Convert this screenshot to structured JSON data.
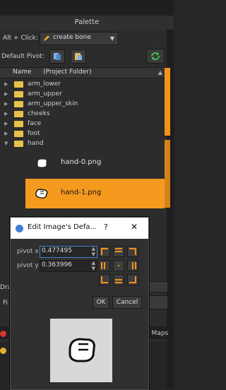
{
  "panel": {
    "title": "Palette"
  },
  "toolbar": {
    "alt_click_label": "Alt + Click:",
    "alt_click_value": "create bone",
    "default_pivot_label": "Default Pivot:"
  },
  "tree": {
    "col_name": "Name",
    "col_folder": "(Project Folder)",
    "folders": [
      "arm_lower",
      "arm_upper",
      "arm_upper_skin",
      "cheeks",
      "face",
      "foot",
      "hand"
    ],
    "files": [
      "hand-0.png",
      "hand-1.png"
    ]
  },
  "background_fragments": {
    "left1": "Dra",
    "left2": "Fi",
    "right_tab": "r Maps"
  },
  "dialog": {
    "title": "Edit Image's Defa...",
    "help": "?",
    "close": "✕",
    "pivot_x_label": "pivot x",
    "pivot_x_value": "0.477495",
    "pivot_y_label": "pivot y",
    "pivot_y_value": "0.363996",
    "ok_label": "OK",
    "cancel_label": "Cancel"
  },
  "colors": {
    "accent": "#f59a1f",
    "folder": "#e8c24a",
    "background": "#2c2c2c"
  },
  "icons": [
    "pencil-icon",
    "copy-pivot-icon",
    "paste-pivot-icon",
    "refresh-icon",
    "folder-icon",
    "globe-icon",
    "hand-icon"
  ]
}
